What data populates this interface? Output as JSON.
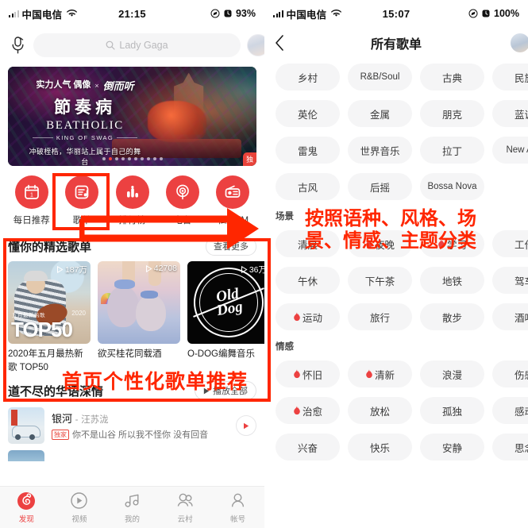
{
  "left_phone": {
    "status_bar": {
      "carrier": "中国电信",
      "time": "21:15",
      "battery": "93%",
      "wifi_icon": "wifi-icon",
      "signal_icon": "signal-bars-icon",
      "location_icon": "location-icon",
      "alarm_icon": "alarm-icon"
    },
    "search": {
      "mic_icon": "voice-mic-icon",
      "search_icon": "search-icon",
      "placeholder": "Lady Gaga",
      "value": ""
    },
    "banner": {
      "line1_a": "实力人气\n偶像",
      "line1_x": "×",
      "line1_b": "倒而听",
      "title": "節奏病",
      "subtitle": "BEATHOLIC",
      "subtitle2": "KING OF SWAG",
      "tagline": "冲破桎梏，华丽站上属于自己的舞台",
      "badge": "独",
      "dots_total": 10,
      "dot_active_index": 1
    },
    "quick_entries": [
      {
        "label": "每日推荐",
        "icon": "calendar-icon"
      },
      {
        "label": "歌单",
        "icon": "playlist-icon"
      },
      {
        "label": "排行榜",
        "icon": "chart-bars-icon"
      },
      {
        "label": "电台",
        "icon": "radio-signal-icon"
      },
      {
        "label": "私人FM",
        "icon": "fm-radio-icon"
      }
    ],
    "playlist_section": {
      "title": "懂你的精选歌单",
      "more_label": "查看更多",
      "more_chevron_icon": "chevron-right-icon",
      "cards": [
        {
          "name": "2020年五月最热新歌 TOP50",
          "play_count": "187万",
          "play_icon": "play-triangle-icon",
          "cover_top50": "TOP50",
          "cover_badge": "五月最新热歌",
          "cover_year": "2020"
        },
        {
          "name": "欲买桂花同载酒",
          "play_count": "42708",
          "play_icon": "play-triangle-icon"
        },
        {
          "name": "O-DOG编舞音乐",
          "play_count": "36万",
          "play_icon": "play-triangle-icon",
          "cover_logo": "Old\nDog"
        }
      ]
    },
    "second_section": {
      "title": "道不尽的华语深情",
      "play_all_label": "播放全部",
      "play_all_icon": "play-triangle-icon",
      "songs": [
        {
          "title": "银河",
          "dash": "-",
          "artist": "汪苏泷",
          "exclusive_badge": "独家",
          "lyric": "你不是山谷 所以我不怪你 没有回音",
          "play_icon": "play-circle-icon"
        }
      ]
    },
    "tabbar": [
      {
        "label": "发现",
        "icon": "netease-logo-icon",
        "active": true
      },
      {
        "label": "视频",
        "icon": "video-play-icon",
        "active": false
      },
      {
        "label": "我的",
        "icon": "music-note-icon",
        "active": false
      },
      {
        "label": "云村",
        "icon": "community-icon",
        "active": false
      },
      {
        "label": "帐号",
        "icon": "account-person-icon",
        "active": false
      }
    ]
  },
  "right_phone": {
    "status_bar": {
      "carrier": "中国电信",
      "time": "15:07",
      "battery": "100%",
      "wifi_icon": "wifi-icon",
      "signal_icon": "signal-bars-icon",
      "location_icon": "location-icon",
      "alarm_icon": "alarm-icon"
    },
    "nav": {
      "back_icon": "chevron-left-icon",
      "title": "所有歌单",
      "avatar_icon": "avatar-icon"
    },
    "tag_groups": [
      {
        "label": "",
        "rows": [
          [
            {
              "text": "乡村",
              "hot": false
            },
            {
              "text": "R&B/Soul",
              "hot": false,
              "en": true
            },
            {
              "text": "古典",
              "hot": false
            },
            {
              "text": "民族",
              "hot": false
            }
          ],
          [
            {
              "text": "英伦",
              "hot": false
            },
            {
              "text": "金属",
              "hot": false
            },
            {
              "text": "朋克",
              "hot": false
            },
            {
              "text": "蓝调",
              "hot": false
            }
          ],
          [
            {
              "text": "雷鬼",
              "hot": false
            },
            {
              "text": "世界音乐",
              "hot": false
            },
            {
              "text": "拉丁",
              "hot": false
            },
            {
              "text": "New Age",
              "hot": false,
              "en": true
            }
          ],
          [
            {
              "text": "古风",
              "hot": false
            },
            {
              "text": "后摇",
              "hot": false
            },
            {
              "text": "Bossa Nova",
              "hot": false,
              "en": true
            },
            {
              "text": "",
              "hot": false,
              "hidden": true
            }
          ]
        ]
      },
      {
        "label": "场景",
        "rows": [
          [
            {
              "text": "清晨",
              "hot": false
            },
            {
              "text": "夜晚",
              "hot": true
            },
            {
              "text": "学习",
              "hot": true
            },
            {
              "text": "工作",
              "hot": false
            }
          ],
          [
            {
              "text": "午休",
              "hot": false
            },
            {
              "text": "下午茶",
              "hot": false
            },
            {
              "text": "地铁",
              "hot": false
            },
            {
              "text": "驾车",
              "hot": false
            }
          ],
          [
            {
              "text": "运动",
              "hot": true
            },
            {
              "text": "旅行",
              "hot": false
            },
            {
              "text": "散步",
              "hot": false
            },
            {
              "text": "酒吧",
              "hot": false
            }
          ]
        ]
      },
      {
        "label": "情感",
        "rows": [
          [
            {
              "text": "怀旧",
              "hot": true
            },
            {
              "text": "清新",
              "hot": true
            },
            {
              "text": "浪漫",
              "hot": false
            },
            {
              "text": "伤感",
              "hot": false
            }
          ],
          [
            {
              "text": "治愈",
              "hot": true
            },
            {
              "text": "放松",
              "hot": false
            },
            {
              "text": "孤独",
              "hot": false
            },
            {
              "text": "感动",
              "hot": false
            }
          ],
          [
            {
              "text": "兴奋",
              "hot": false
            },
            {
              "text": "快乐",
              "hot": false
            },
            {
              "text": "安静",
              "hot": false
            },
            {
              "text": "思念",
              "hot": false
            }
          ]
        ]
      }
    ]
  },
  "annotations": {
    "color": "#ff2600",
    "home_recommend_text": "首页个性化歌单推荐",
    "category_text": "按照语种、风格、场\n景、情感、主题分类",
    "arrow_icon": "arrow-right-icon",
    "box_playlist_icon_label": "highlight-playlist-entry",
    "box_recommend_label": "highlight-home-playlist-recommend"
  }
}
